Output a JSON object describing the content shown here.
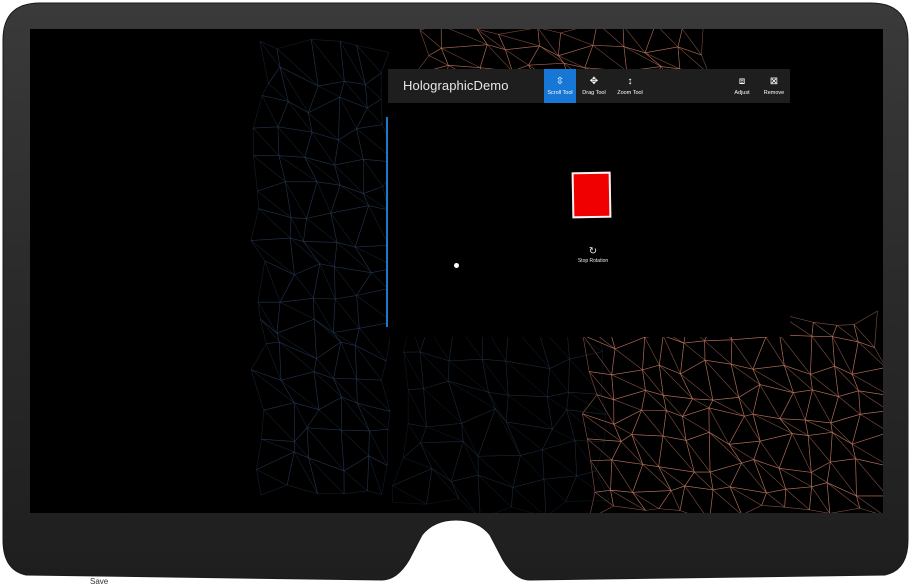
{
  "app": {
    "title": "HolographicDemo"
  },
  "toolbar": {
    "tools": [
      {
        "label": "Scroll Tool",
        "icon": "scroll-arrows-icon",
        "active": true
      },
      {
        "label": "Drag Tool",
        "icon": "move-arrows-icon",
        "active": false
      },
      {
        "label": "Zoom Tool",
        "icon": "zoom-arrows-icon",
        "active": false
      }
    ],
    "actions": [
      {
        "label": "Adjust",
        "icon": "adjust-cube-icon"
      },
      {
        "label": "Remove",
        "icon": "remove-cube-icon"
      }
    ]
  },
  "content": {
    "rotating_object": {
      "color": "#f00000",
      "border": "#f4f4f4"
    },
    "stop_rotation": {
      "label": "Stop Rotation",
      "icon": "refresh-icon"
    }
  },
  "below_label": "Save",
  "colors": {
    "accent": "#1677d6",
    "frame": "#333333",
    "titlebar": "#1e1e1e",
    "mesh_warm": "#d8866a",
    "mesh_cool": "#3a5a80"
  }
}
